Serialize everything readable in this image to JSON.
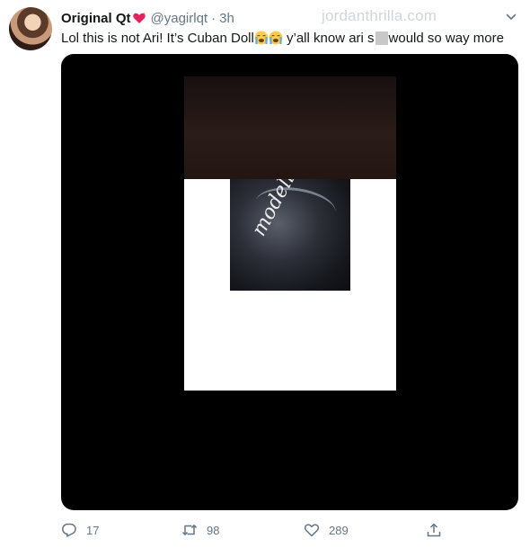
{
  "tweet": {
    "display_name": "Original Qt",
    "handle": "@yagirlqt",
    "separator": "·",
    "time": "3h",
    "text_part1": "Lol this is not Ari! It’s Cuban Doll",
    "text_part2": " y’all know ari s",
    "text_part3": "would so way more"
  },
  "watermark": "jordanthrilla.com",
  "media": {
    "video_watermark": "modelltearoom"
  },
  "actions": {
    "reply_count": "17",
    "retweet_count": "98",
    "like_count": "289"
  },
  "icons": {
    "avatar": "profile-avatar",
    "name_emoji": "heart-emoji",
    "text_emoji": "crying-emoji",
    "more": "chevron-down-icon",
    "reply": "reply-icon",
    "retweet": "retweet-icon",
    "like": "heart-icon",
    "share": "share-icon"
  },
  "colors": {
    "text": "#14171a",
    "secondary": "#657786",
    "heart": "#e0245e",
    "emoji": "#ffcc4d"
  }
}
